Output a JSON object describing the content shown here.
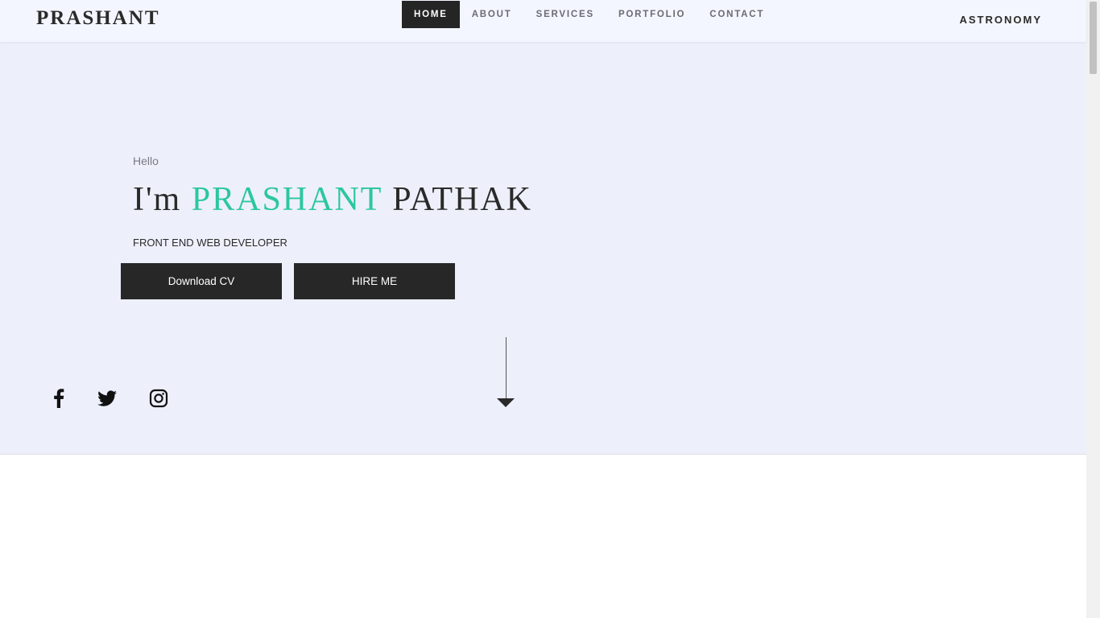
{
  "navbar": {
    "brand": "PRASHANT",
    "links": [
      {
        "label": "HOME",
        "active": true
      },
      {
        "label": "ABOUT"
      },
      {
        "label": "SERVICES"
      },
      {
        "label": "PORTFOLIO"
      },
      {
        "label": "CONTACT"
      }
    ],
    "right_link": "ASTRONOMY"
  },
  "hero": {
    "greeting": "Hello",
    "headline_prefix": "I'm ",
    "headline_first": "PRASHANT",
    "headline_last": " PATHAK",
    "role": "FRONT END WEB DEVELOPER",
    "buttons": {
      "download_cv": "Download CV",
      "hire_me": "HIRE ME"
    },
    "social_icons": [
      "facebook-icon",
      "twitter-icon",
      "instagram-icon"
    ],
    "scroll_indicator_icon": "arrow-down-icon"
  },
  "colors": {
    "accent": "#2cc79f",
    "dark": "#272727",
    "hero_bg": "#edf0fb",
    "nav_bg": "#f3f6fe"
  }
}
